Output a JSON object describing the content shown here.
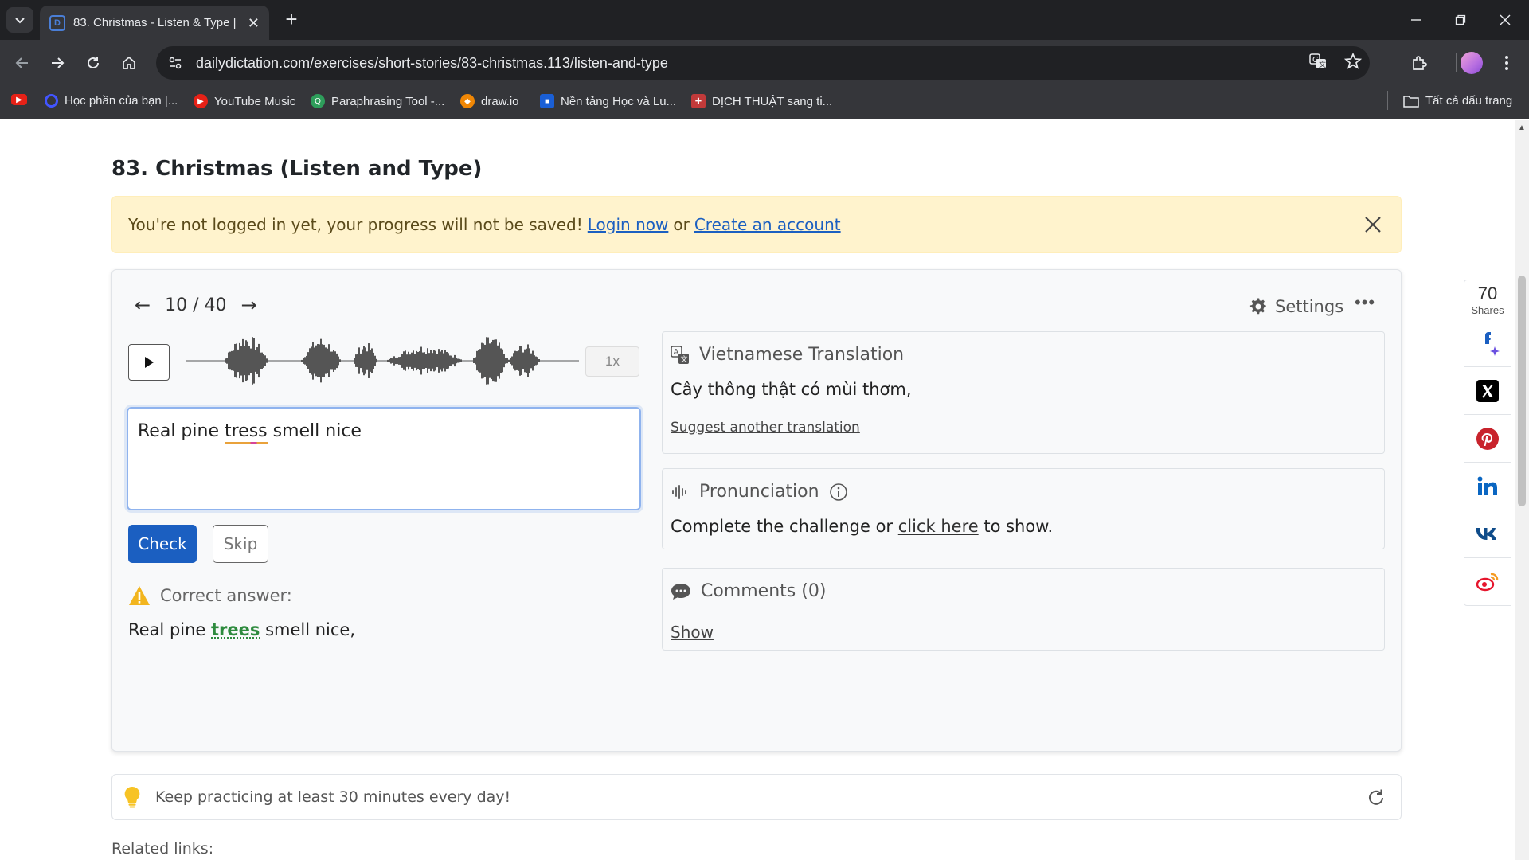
{
  "browser": {
    "tab_title": "83. Christmas - Listen & Type | S",
    "url": "dailydictation.com/exercises/short-stories/83-christmas.113/listen-and-type",
    "bookmarks": [
      "Học phần của bạn |...",
      "YouTube Music",
      "Paraphrasing Tool -...",
      "draw.io",
      "Nền tảng Học và Lu...",
      "DỊCH THUẬT sang ti..."
    ],
    "all_bookmarks": "Tất cả dấu trang"
  },
  "page": {
    "title": "83. Christmas (Listen and Type)",
    "alert": {
      "text": "You're not logged in yet, your progress will not be saved!",
      "login": "Login now",
      "or": "or",
      "create": "Create an account"
    },
    "pager": {
      "current": "10",
      "sep": "/",
      "total": "40"
    },
    "settings": "Settings",
    "speed": "1x",
    "answer_before": "Real pine ",
    "answer_typo": "tress",
    "answer_after": " smell nice",
    "check": "Check",
    "skip": "Skip",
    "correct_label": "Correct answer:",
    "correct_before": "Real pine ",
    "correct_fix": "trees",
    "correct_after": " smell nice,",
    "translation": {
      "title": "Vietnamese Translation",
      "text": "Cây thông thật có mùi thơm,",
      "suggest": "Suggest another translation"
    },
    "pronunciation": {
      "title": "Pronunciation",
      "before": "Complete the challenge or",
      "link": "click here",
      "after": "to show."
    },
    "comments": {
      "title": "Comments (0)",
      "show": "Show"
    },
    "tip": "Keep practicing at least 30 minutes every day!",
    "related": "Related links:",
    "shares": {
      "count": "70",
      "label": "Shares"
    }
  },
  "colors": {
    "primary": "#1b5fc1",
    "alert_bg": "#fff3cd",
    "correct_green": "#2e8b3e",
    "chrome_dark": "#202124",
    "chrome_toolbar": "#35363a"
  }
}
